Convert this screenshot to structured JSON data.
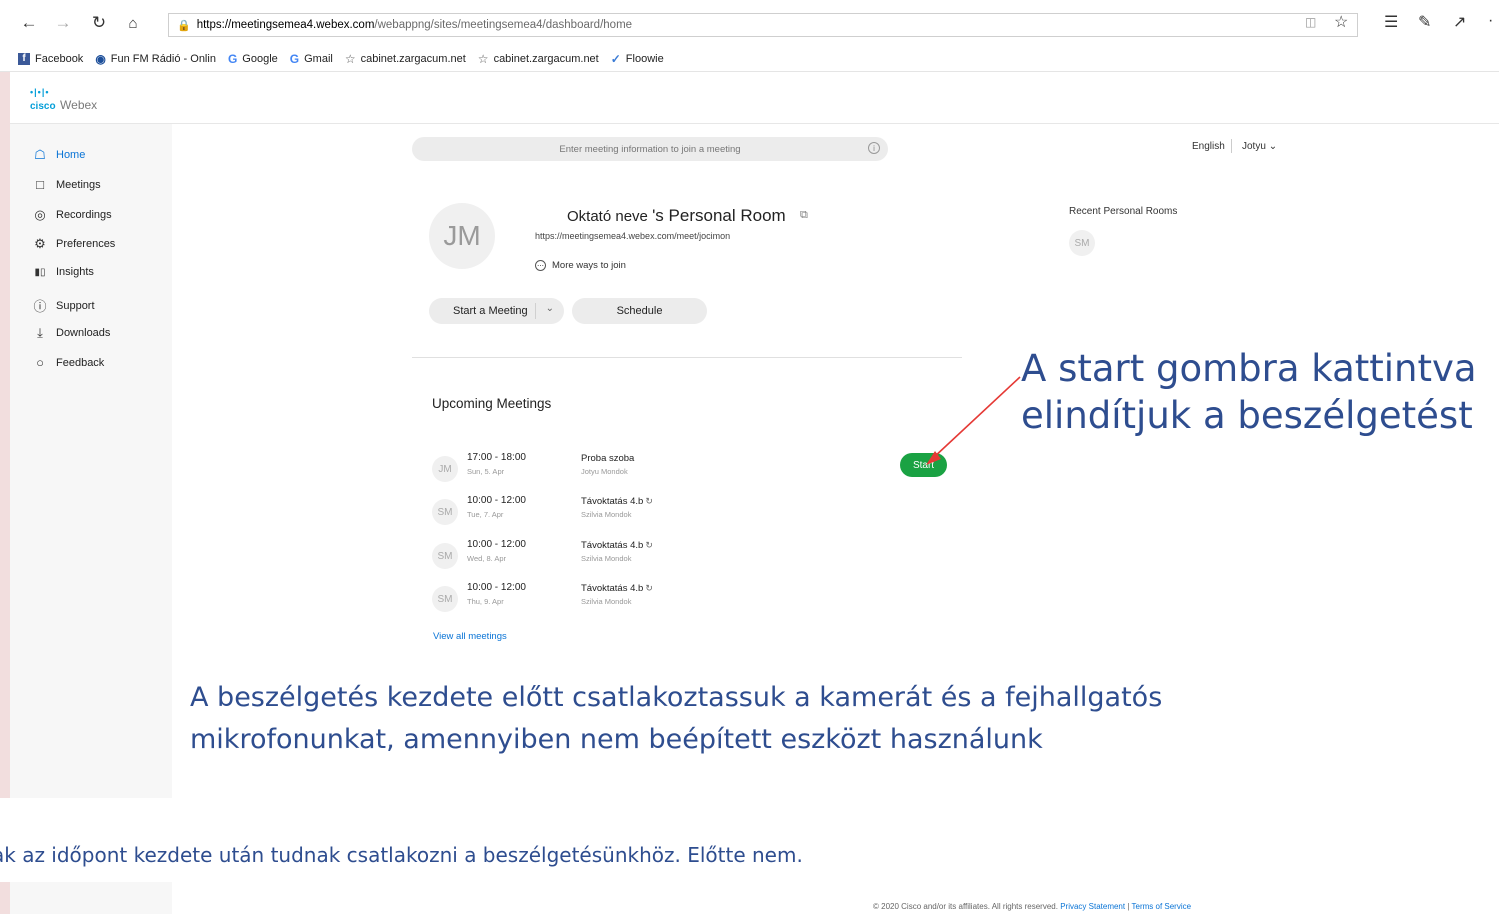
{
  "browser": {
    "url_host": "https://meetingsemea4.webex.com",
    "url_path": "/webappng/sites/meetingsemea4/dashboard/home",
    "bookmarks": [
      {
        "label": "Facebook",
        "icon": "facebook-icon"
      },
      {
        "label": "Fun FM Rádió - Onlin",
        "icon": "radio-icon"
      },
      {
        "label": "Google",
        "icon": "google-icon"
      },
      {
        "label": "Gmail",
        "icon": "google-icon"
      },
      {
        "label": "cabinet.zargacum.net",
        "icon": "star-icon"
      },
      {
        "label": "cabinet.zargacum.net",
        "icon": "star-icon"
      },
      {
        "label": "Floowie",
        "icon": "floowie-icon"
      }
    ]
  },
  "header": {
    "logo_brand": "cisco",
    "logo_product": "Webex"
  },
  "sidebar": {
    "items": [
      {
        "label": "Home",
        "icon": "home-icon",
        "active": true
      },
      {
        "label": "Meetings",
        "icon": "calendar-icon"
      },
      {
        "label": "Recordings",
        "icon": "record-icon"
      },
      {
        "label": "Preferences",
        "icon": "gear-icon"
      },
      {
        "label": "Insights",
        "icon": "chart-icon"
      },
      {
        "label": "Support",
        "icon": "help-icon"
      },
      {
        "label": "Downloads",
        "icon": "download-icon"
      },
      {
        "label": "Feedback",
        "icon": "chat-icon"
      }
    ]
  },
  "topbar": {
    "search_placeholder": "Enter meeting information to join a meeting",
    "language": "English",
    "user": "Jotyu"
  },
  "personal_room": {
    "avatar": "JM",
    "owner": "Oktató neve",
    "title_suffix": "'s Personal Room",
    "url": "https://meetingsemea4.webex.com/meet/jocimon",
    "more_ways": "More ways to join",
    "start_label": "Start a Meeting",
    "schedule_label": "Schedule"
  },
  "recent": {
    "title": "Recent Personal Rooms",
    "avatar": "SM"
  },
  "upcoming": {
    "title": "Upcoming Meetings",
    "meetings": [
      {
        "avatar": "JM",
        "time": "17:00 - 18:00",
        "date": "Sun, 5. Apr",
        "name": "Proba szoba",
        "host": "Jotyu Mondok",
        "recurring": false
      },
      {
        "avatar": "SM",
        "time": "10:00 - 12:00",
        "date": "Tue, 7. Apr",
        "name": "Távoktatás 4.b",
        "host": "Szilvia Mondok",
        "recurring": true
      },
      {
        "avatar": "SM",
        "time": "10:00 - 12:00",
        "date": "Wed, 8. Apr",
        "name": "Távoktatás 4.b",
        "host": "Szilvia Mondok",
        "recurring": true
      },
      {
        "avatar": "SM",
        "time": "10:00 - 12:00",
        "date": "Thu, 9. Apr",
        "name": "Távoktatás 4.b",
        "host": "Szilvia Mondok",
        "recurring": true
      }
    ],
    "start_label": "Start",
    "view_all": "View all meetings"
  },
  "annotations": {
    "right_line1": "A start gombra kattintva",
    "right_line2": "elindítjuk a beszélgetést",
    "mid_line1": "A beszélgetés kezdete előtt csatlakoztassuk a kamerát és a fejhallgatós",
    "mid_line2": "mikrofonunkat, amennyiben nem beépített eszközt használunk",
    "bottom": "ak az időpont kezdete után tudnak csatlakozni a beszélgetésünkhöz. Előtte nem."
  },
  "footer": {
    "copyright": "© 2020 Cisco and/or its affiliates. All rights reserved.",
    "privacy": "Privacy Statement",
    "terms": "Terms of Service"
  },
  "colors": {
    "accent": "#0a74d6",
    "start_green": "#1aa243",
    "annotation": "#2e4d8f",
    "arrow": "#e53935"
  }
}
